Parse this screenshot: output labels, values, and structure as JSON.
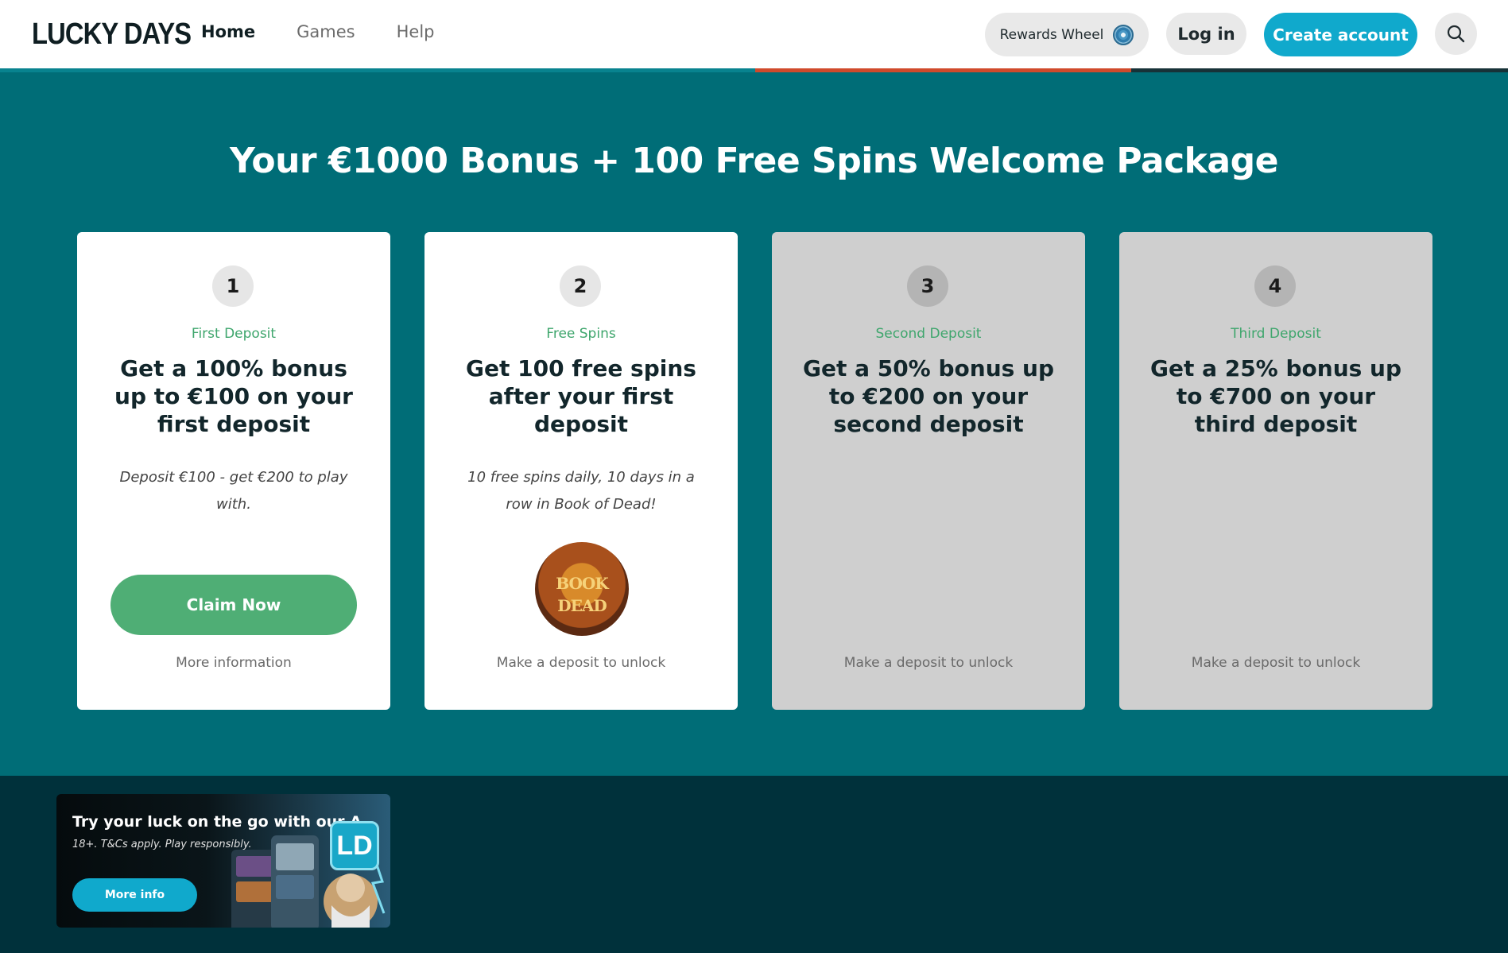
{
  "header": {
    "logo_text": "LUCKY DAYS",
    "nav": [
      {
        "label": "Home",
        "active": true
      },
      {
        "label": "Games",
        "active": false
      },
      {
        "label": "Help",
        "active": false
      }
    ],
    "rewards_label": "Rewards Wheel",
    "rewards_icon": "prize-wheel-icon",
    "login_label": "Log in",
    "create_label": "Create account",
    "search_icon": "search-icon"
  },
  "progress": {
    "fraction": 0.75
  },
  "hero": {
    "title": "Your €1000 Bonus + 100 Free Spins Welcome Package",
    "cards": [
      {
        "number": "1",
        "kicker": "First Deposit",
        "headline": "Get a 100% bonus up to €100 on your first deposit",
        "description": "Deposit €100 - get €200 to play with.",
        "cta": "Claim Now",
        "footer": "More information",
        "locked": false
      },
      {
        "number": "2",
        "kicker": "Free Spins",
        "headline": "Get 100 free spins after your first deposit",
        "description": "10 free spins daily, 10 days in a row in Book of Dead!",
        "game_logo_line1": "BOOK",
        "game_logo_line2": "DEAD",
        "footer": "Make a deposit to unlock",
        "locked": false
      },
      {
        "number": "3",
        "kicker": "Second Deposit",
        "headline": "Get a 50% bonus up to €200 on your second deposit",
        "footer": "Make a deposit to unlock",
        "locked": true
      },
      {
        "number": "4",
        "kicker": "Third Deposit",
        "headline": "Get a 25% bonus up to €700 on your third deposit",
        "footer": "Make a deposit to unlock",
        "locked": true
      }
    ]
  },
  "banner": {
    "title": "Try your luck on the go with our Andr...",
    "subtitle": "18+. T&Cs apply. Play responsibly.",
    "button": "More info",
    "badge": "LD"
  },
  "colors": {
    "hero_bg": "#006d77",
    "accent_green": "#4fae75",
    "accent_blue": "#10a9cc",
    "footer_bg": "#00313b"
  }
}
